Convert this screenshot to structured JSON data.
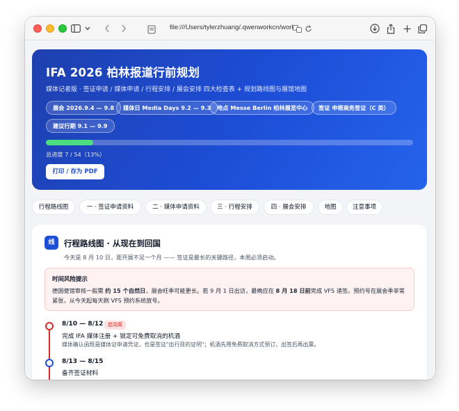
{
  "browser": {
    "address": "file:///Users/tylerzhuang/.qwenworkcn/workspace"
  },
  "hero": {
    "title": "IFA 2026 柏林报道行前规划",
    "subtitle": "媒体记者版 · 签证申请 / 媒体申请 / 行程安排 / 展会安排 四大检查表 + 规划路线图与展馆地图",
    "chips": [
      "展会 2026.9.4 — 9.8",
      "媒体日 Media Days 9.2 — 9.3",
      "地点 Messe Berlin 柏林展览中心",
      "签证 申根商务签证（C 类）",
      "建议行期 9.1 — 9.9"
    ],
    "progress": {
      "done": 7,
      "total": 54,
      "percent": 13,
      "text": "总进度 7 / 54（13%）"
    },
    "print_label": "打印 / 存为 PDF"
  },
  "tabs": [
    "行程路线图",
    "一 · 签证申请资料",
    "二 · 媒体申请资料",
    "三 · 行程安排",
    "四 · 展会安排",
    "地图",
    "注意事项"
  ],
  "section": {
    "badge": "线",
    "title": "行程路线图 · 从现在到回国",
    "subtitle": "今天是 8 月 10 日，距开展不足一个月 —— 签证是最长的关键路径，本周必须启动。"
  },
  "alert": {
    "title": "时间风险提示",
    "p1": "德国使馆审核一般需 ",
    "b1": "约 15 个自然日",
    "p2": "，展会旺季可能更长。若 9 月 1 日出访，最晚应在 ",
    "b2": "8 月 18 日前",
    "p3": "完成 VFS 递签。预约号在展会季非常紧张，从今天起每天刷 VFS 预约系统放号。"
  },
  "timeline": [
    {
      "date": "8/10 — 8/12",
      "tag": "启动周",
      "title": "完成 IFA 媒体注册 + 锁定可免费取消的机酒",
      "desc": "媒体确认函既是媒体证申请凭证，也是签证\"出行目的证明\"；机酒先用免费取消方式预订，出签后再出票。"
    },
    {
      "date": "8/13 — 8/15",
      "title": "备齐签证材料"
    }
  ],
  "colors": {
    "hero_start": "#1e40af",
    "hero_end": "#2563eb",
    "progress": "#4ade80",
    "accent": "#1d4ed8",
    "danger": "#dc2626"
  },
  "icons": [
    "sidebar-icon",
    "chevron-down-icon",
    "back-icon",
    "forward-icon",
    "page-icon",
    "translate-icon",
    "reload-icon",
    "download-icon",
    "share-icon",
    "plus-icon",
    "tabs-icon"
  ]
}
